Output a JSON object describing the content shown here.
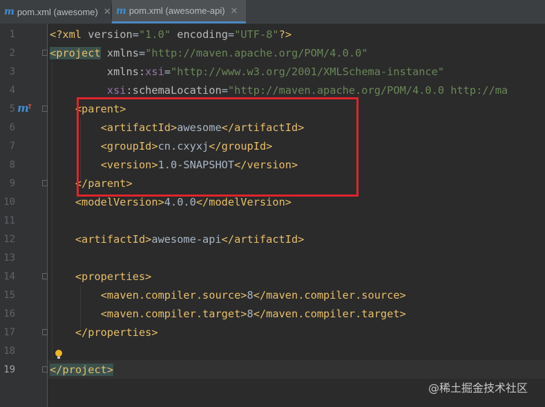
{
  "tabs": [
    {
      "label": "pom.xml (awesome)",
      "active": false,
      "icon": "maven-icon"
    },
    {
      "label": "pom.xml (awesome-api)",
      "active": true,
      "icon": "maven-icon"
    }
  ],
  "line_numbers": [
    "1",
    "2",
    "3",
    "4",
    "5",
    "6",
    "7",
    "8",
    "9",
    "10",
    "11",
    "12",
    "13",
    "14",
    "15",
    "16",
    "17",
    "18",
    "19"
  ],
  "code": {
    "l1": {
      "a": "<?xml ",
      "b": "version",
      "c": "=",
      "d": "\"1.0\"",
      "e": " ",
      "f": "encoding",
      "g": "=",
      "h": "\"UTF-8\"",
      "i": "?>"
    },
    "l2": {
      "open": "<project",
      "sp": " ",
      "attr": "xmlns",
      "eq": "=",
      "val": "\"http://maven.apache.org/POM/4.0.0\""
    },
    "l3": {
      "indent": "         ",
      "attr": "xmlns",
      "colon": ":",
      "ns": "xsi",
      "eq": "=",
      "val": "\"http://www.w3.org/2001/XMLSchema-instance\""
    },
    "l4": {
      "indent": "         ",
      "ns": "xsi",
      "colon": ":",
      "attr": "schemaLocation",
      "eq": "=",
      "val": "\"http://maven.apache.org/POM/4.0.0 http://ma"
    },
    "l5": {
      "indent": "    ",
      "tag": "<parent>"
    },
    "l6": {
      "indent": "        ",
      "o": "<artifactId>",
      "t": "awesome",
      "c": "</artifactId>"
    },
    "l7": {
      "indent": "        ",
      "o": "<groupId>",
      "t": "cn.cxyxj",
      "c": "</groupId>"
    },
    "l8": {
      "indent": "        ",
      "o": "<version>",
      "t": "1.0-SNAPSHOT",
      "c": "</version>"
    },
    "l9": {
      "indent": "    ",
      "tag": "</parent>"
    },
    "l10": {
      "indent": "    ",
      "o": "<modelVersion>",
      "t": "4.0.0",
      "c": "</modelVersion>"
    },
    "l12": {
      "indent": "    ",
      "o": "<artifactId>",
      "t": "awesome-api",
      "c": "</artifactId>"
    },
    "l14": {
      "indent": "    ",
      "tag": "<properties>"
    },
    "l15": {
      "indent": "        ",
      "o": "<maven.compiler.source>",
      "t": "8",
      "c": "</maven.compiler.source>"
    },
    "l16": {
      "indent": "        ",
      "o": "<maven.compiler.target>",
      "t": "8",
      "c": "</maven.compiler.target>"
    },
    "l17": {
      "indent": "    ",
      "tag": "</properties>"
    },
    "l19": {
      "tag": "</project>"
    }
  },
  "gutter_marker": {
    "letter": "m",
    "arrow": "↑"
  },
  "watermark": "@稀土掘金技术社区",
  "colors": {
    "background": "#2b2b2b",
    "tag": "#e8bf6a",
    "value": "#6a8759",
    "namespace": "#9876aa",
    "highlight_box": "#e0242b",
    "tab_accent": "#4a88c7"
  }
}
